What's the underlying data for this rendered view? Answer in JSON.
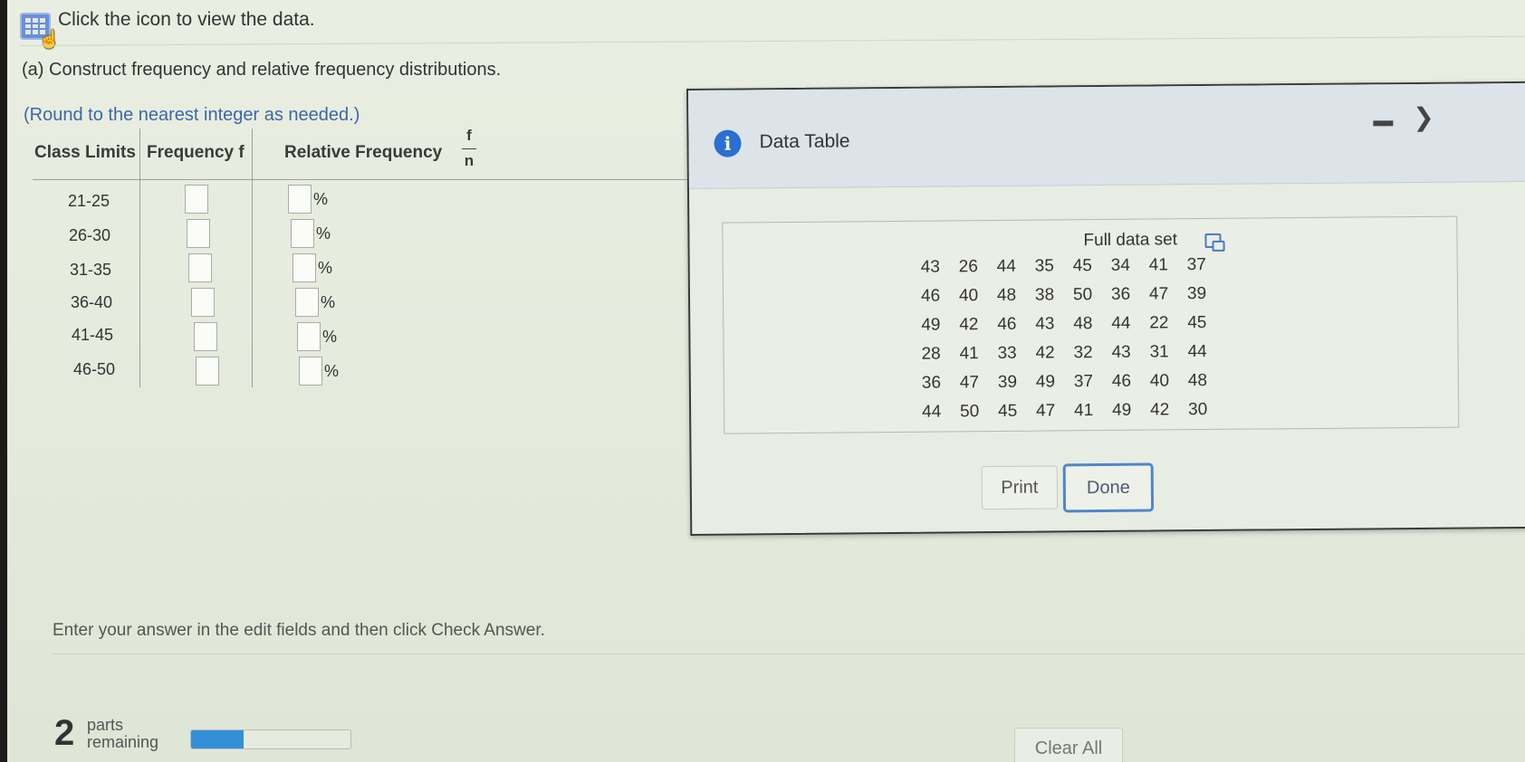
{
  "instruction": "Click the icon to view the data.",
  "part_a": "(a) Construct frequency and relative frequency distributions.",
  "round_note": "(Round to the nearest integer as needed.)",
  "table": {
    "headers": {
      "class_limits": "Class Limits",
      "frequency": "Frequency f",
      "relative_frequency": "Relative Frequency",
      "fraction_num": "f",
      "fraction_den": "n"
    },
    "rows": [
      {
        "class": "21-25",
        "frequency": "",
        "relative": "",
        "pct": "%"
      },
      {
        "class": "26-30",
        "frequency": "",
        "relative": "",
        "pct": "%"
      },
      {
        "class": "31-35",
        "frequency": "",
        "relative": "",
        "pct": "%"
      },
      {
        "class": "36-40",
        "frequency": "",
        "relative": "",
        "pct": "%"
      },
      {
        "class": "41-45",
        "frequency": "",
        "relative": "",
        "pct": "%"
      },
      {
        "class": "46-50",
        "frequency": "",
        "relative": "",
        "pct": "%"
      }
    ]
  },
  "dialog": {
    "title": "Data Table",
    "full_data_set_label": "Full data set",
    "data": [
      [
        "43",
        "26",
        "44",
        "35",
        "45",
        "34",
        "41",
        "37"
      ],
      [
        "46",
        "40",
        "48",
        "38",
        "50",
        "36",
        "47",
        "39"
      ],
      [
        "49",
        "42",
        "46",
        "43",
        "48",
        "44",
        "22",
        "45"
      ],
      [
        "28",
        "41",
        "33",
        "42",
        "32",
        "43",
        "31",
        "44"
      ],
      [
        "36",
        "47",
        "39",
        "49",
        "37",
        "46",
        "40",
        "48"
      ],
      [
        "44",
        "50",
        "45",
        "47",
        "41",
        "49",
        "42",
        "30"
      ]
    ],
    "print_label": "Print",
    "done_label": "Done"
  },
  "footer": {
    "enter_note": "Enter your answer in the edit fields and then click Check Answer.",
    "parts_count": "2",
    "parts_text_1": "parts",
    "parts_text_2": "remaining",
    "progress_fraction": 0.33,
    "clear_all_label": "Clear All"
  }
}
